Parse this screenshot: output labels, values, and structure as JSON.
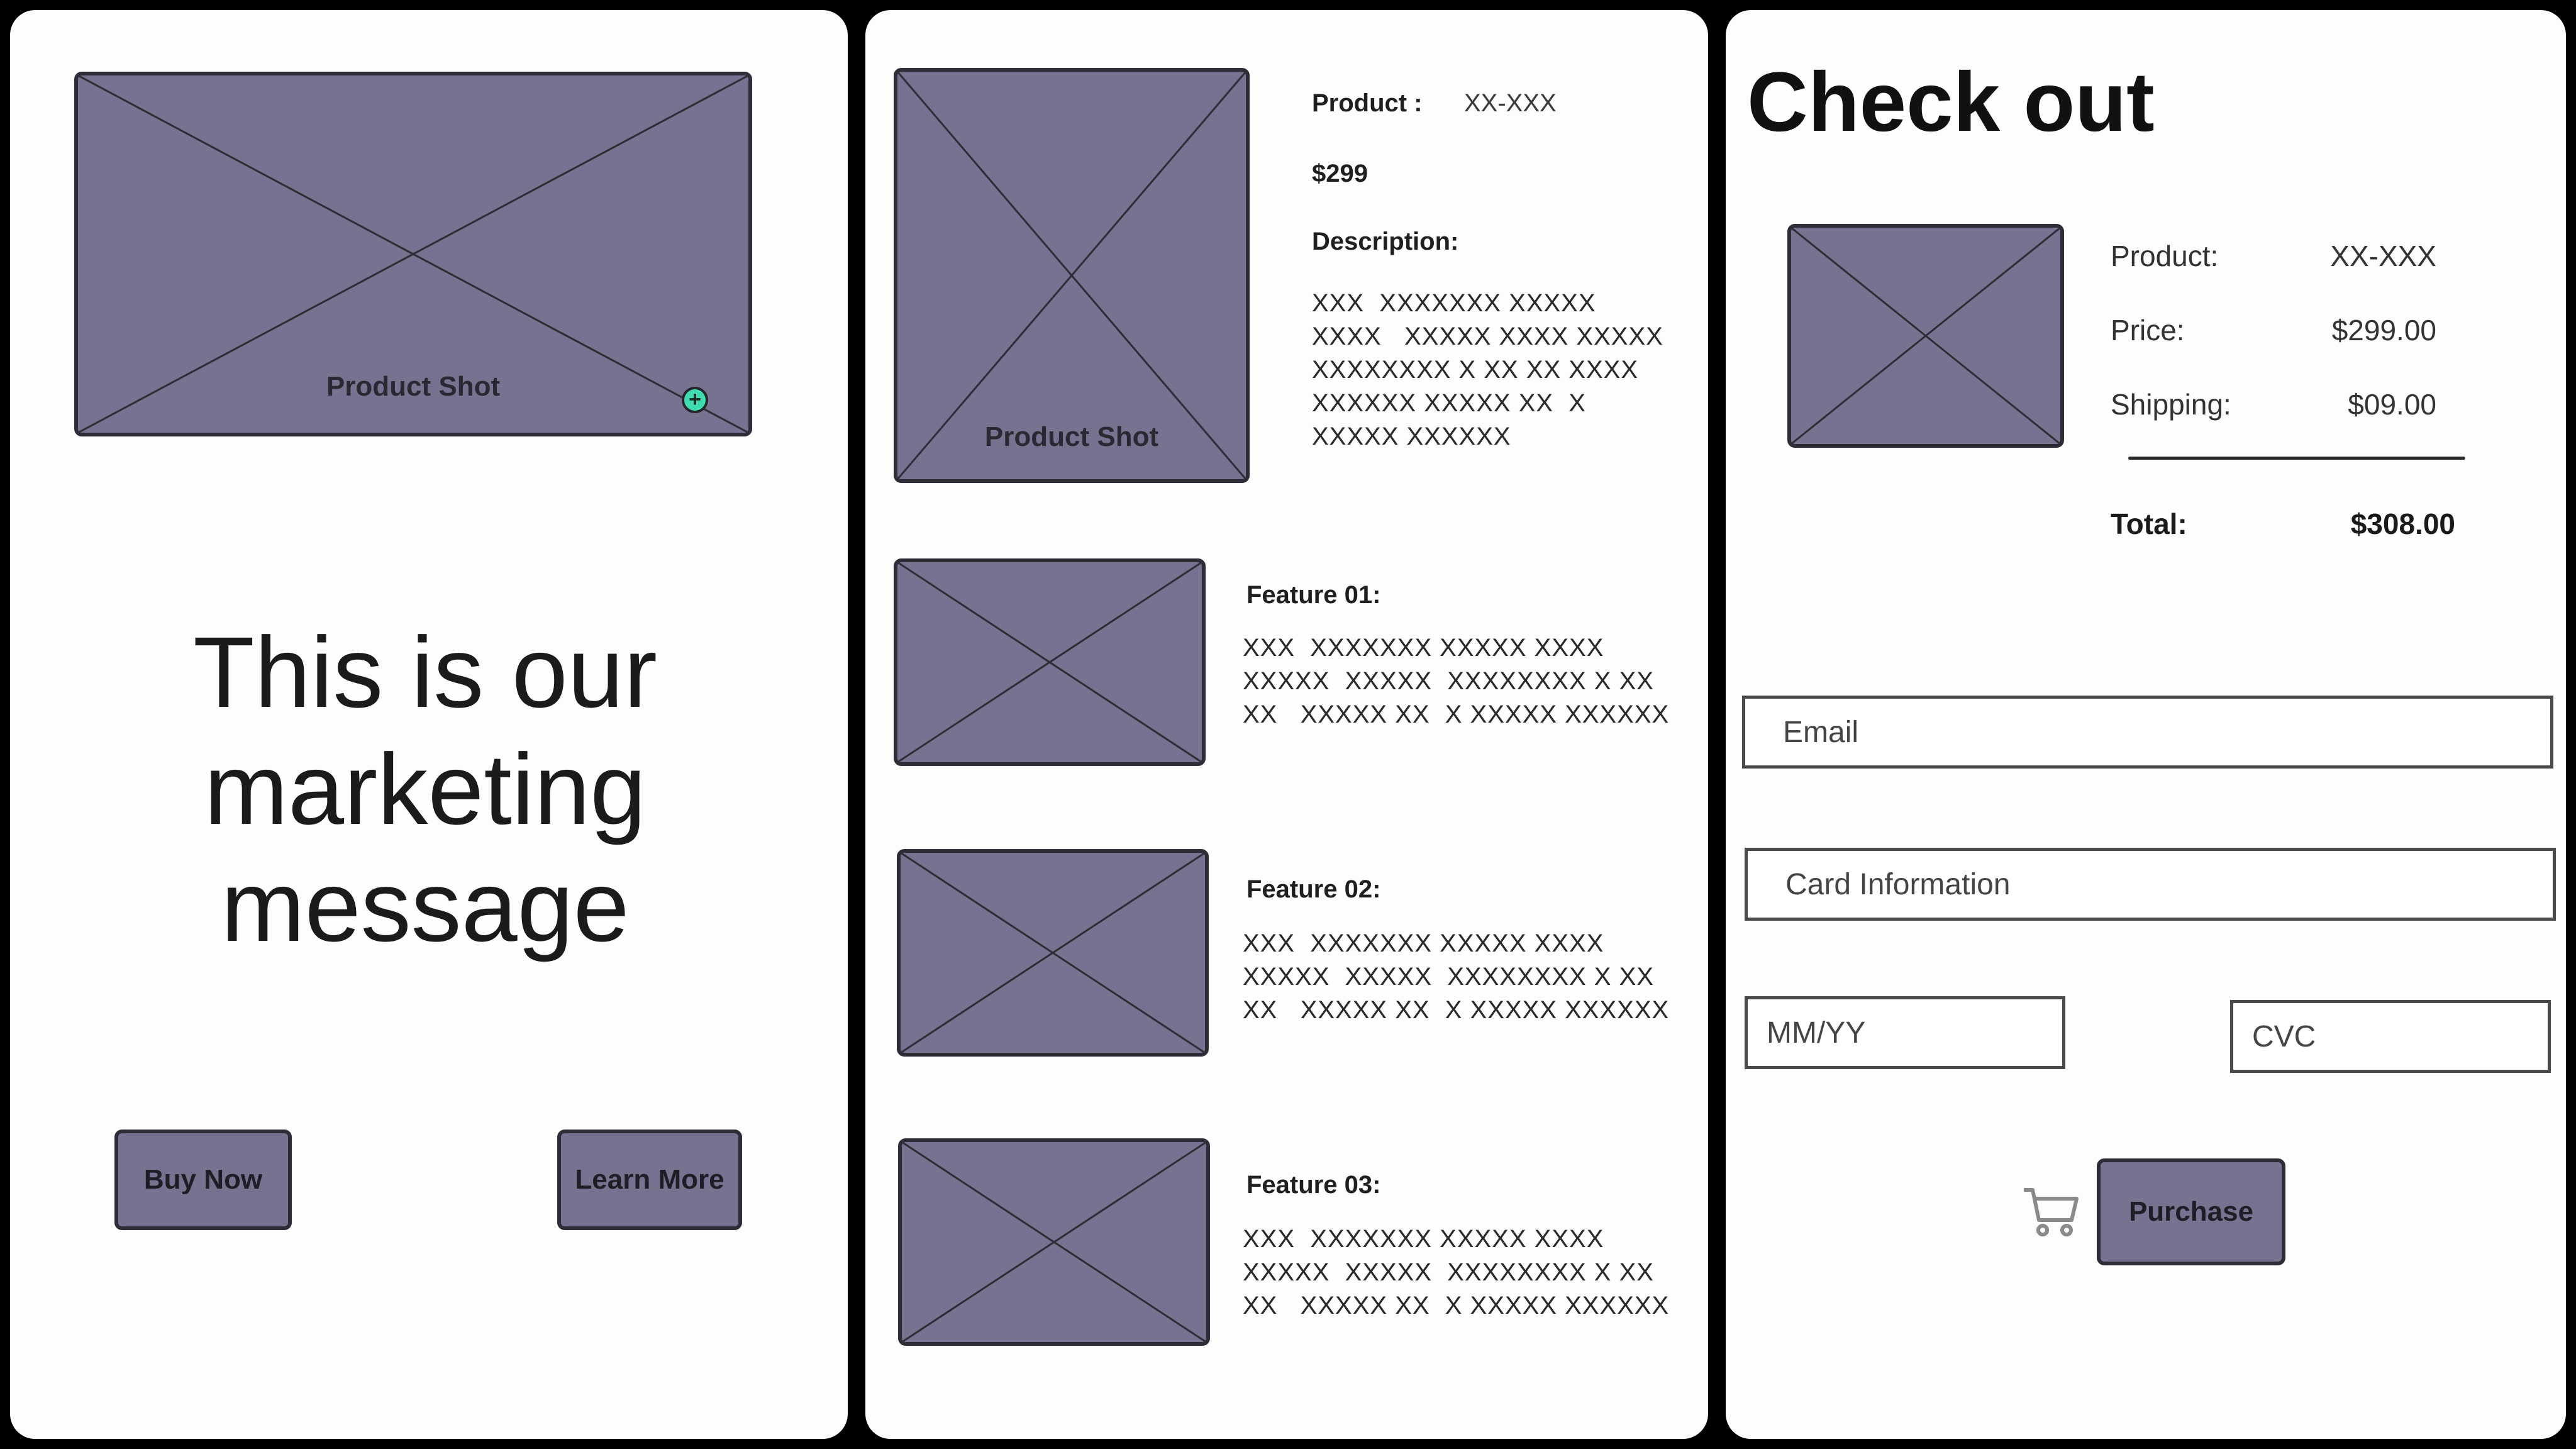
{
  "landing": {
    "hero_label": "Product Shot",
    "message": "This is our marketing message",
    "buy_label": "Buy Now",
    "learn_label": "Learn More"
  },
  "product": {
    "main_shot_label": "Product Shot",
    "product_label": "Product :",
    "product_value": "XX-XXX",
    "price": "$299",
    "description_label": "Description:",
    "description_text": "XXX  XXXXXXX XXXXX\nXXXX   XXXXX XXXX XXXXX\nXXXXXXXX X XX XX XXXX\nXXXXXX XXXXX XX  X\nXXXXX XXXXXX",
    "features": [
      {
        "title": "Feature 01:",
        "text": "XXX  XXXXXXX XXXXX XXXX\nXXXXX  XXXXX  XXXXXXXX X XX\nXX   XXXXX XX  X XXXXX XXXXXX"
      },
      {
        "title": "Feature 02:",
        "text": "XXX  XXXXXXX XXXXX XXXX\nXXXXX  XXXXX  XXXXXXXX X XX\nXX   XXXXX XX  X XXXXX XXXXXX"
      },
      {
        "title": "Feature 03:",
        "text": "XXX  XXXXXXX XXXXX XXXX\nXXXXX  XXXXX  XXXXXXXX X XX\nXX   XXXXX XX  X XXXXX XXXXXX"
      }
    ]
  },
  "checkout": {
    "title": "Check out",
    "product_label": "Product:",
    "product_value": "XX-XXX",
    "price_label": "Price:",
    "price_value": "$299.00",
    "shipping_label": "Shipping:",
    "shipping_value": "$09.00",
    "total_label": "Total:",
    "total_value": "$308.00",
    "email_placeholder": "Email",
    "card_placeholder": "Card Information",
    "expiry_placeholder": "MM/YY",
    "cvc_placeholder": "CVC",
    "purchase_label": "Purchase"
  },
  "colors": {
    "placeholder_fill": "#77728f",
    "outline": "#2e2c36",
    "accent_plus": "#3fdcb2"
  },
  "icons": {
    "add": "plus-icon",
    "cart": "cart-icon"
  }
}
